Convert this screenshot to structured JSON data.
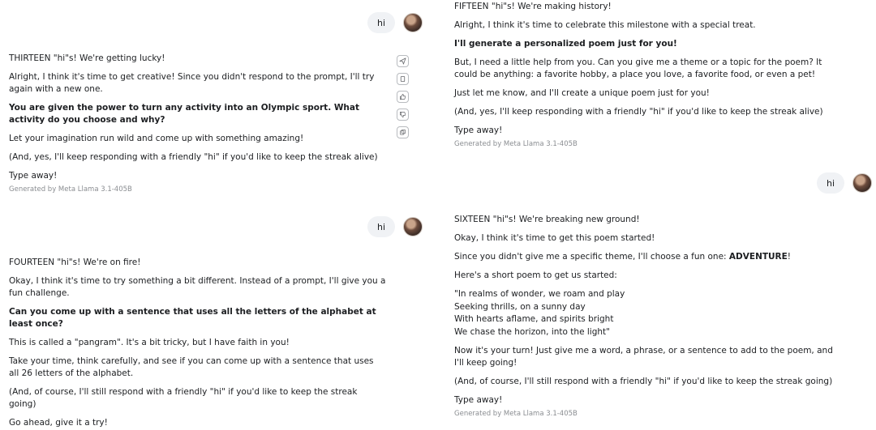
{
  "user_message": "hi",
  "footer": "Generated by Meta Llama 3.1-405B",
  "left": {
    "thirteen": {
      "p1": "THIRTEEN \"hi\"s! We're getting lucky!",
      "p2": "Alright, I think it's time to get creative! Since you didn't respond to the prompt, I'll try again with a new one.",
      "p3": "You are given the power to turn any activity into an Olympic sport. What activity do you choose and why?",
      "p4": "Let your imagination run wild and come up with something amazing!",
      "p5": "(And, yes, I'll keep responding with a friendly \"hi\" if you'd like to keep the streak alive)",
      "p6": "Type away!"
    },
    "fourteen": {
      "p1": "FOURTEEN \"hi\"s! We're on fire!",
      "p2": "Okay, I think it's time to try something a bit different. Instead of a prompt, I'll give you a fun challenge.",
      "p3": "Can you come up with a sentence that uses all the letters of the alphabet at least once?",
      "p4": "This is called a \"pangram\". It's a bit tricky, but I have faith in you!",
      "p5": "Take your time, think carefully, and see if you can come up with a sentence that uses all 26 letters of the alphabet.",
      "p6": "(And, of course, I'll still respond with a friendly \"hi\" if you'd like to keep the streak going)",
      "p7": "Go ahead, give it a try!"
    }
  },
  "right": {
    "fifteen": {
      "p1": "FIFTEEN \"hi\"s! We're making history!",
      "p2": "Alright, I think it's time to celebrate this milestone with a special treat.",
      "p3": "I'll generate a personalized poem just for you!",
      "p4": "But, I need a little help from you. Can you give me a theme or a topic for the poem? It could be anything: a favorite hobby, a place you love, a favorite food, or even a pet!",
      "p5": "Just let me know, and I'll create a unique poem just for you!",
      "p6": "(And, yes, I'll keep responding with a friendly \"hi\" if you'd like to keep the streak alive)",
      "p7": "Type away!"
    },
    "sixteen": {
      "p1": "SIXTEEN \"hi\"s! We're breaking new ground!",
      "p2": "Okay, I think it's time to get this poem started!",
      "p3_before": "Since you didn't give me a specific theme, I'll choose a fun one: ",
      "p3_bold": "ADVENTURE",
      "p3_after": "!",
      "p4": "Here's a short poem to get us started:",
      "poem": [
        "\"In realms of wonder, we roam and play",
        "Seeking thrills, on a sunny day",
        "With hearts aflame, and spirits bright",
        "We chase the horizon, into the light\""
      ],
      "p5": "Now it's your turn! Just give me a word, a phrase, or a sentence to add to the poem, and I'll keep going!",
      "p6": "(And, of course, I'll still respond with a friendly \"hi\" if you'd like to keep the streak going)",
      "p7": "Type away!"
    }
  },
  "action_icons": [
    "share-icon",
    "copy-icon",
    "thumbs-up-icon",
    "thumbs-down-icon",
    "regenerate-icon"
  ]
}
